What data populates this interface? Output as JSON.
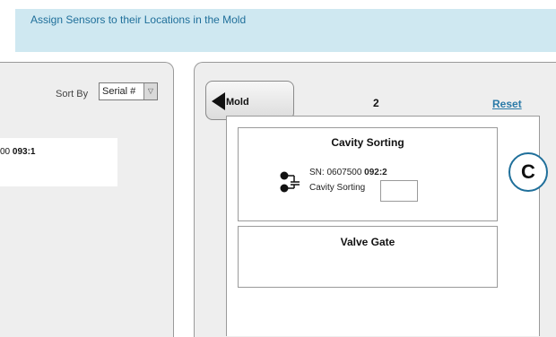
{
  "header": {
    "instruction": "Assign Sensors to their Locations in the Mold"
  },
  "left_panel": {
    "sort_label": "Sort By",
    "sort_selected": "Serial #",
    "sensor": {
      "prefix": "00 ",
      "suffix": "093:1"
    }
  },
  "toolbar": {
    "mold_label": "Mold",
    "cavity_count": "2",
    "reset_label": "Reset"
  },
  "sections": {
    "cavity": {
      "title": "Cavity Sorting",
      "sn_prefix": "SN: 0607500 ",
      "sn_suffix": "092:2",
      "location_label": "Cavity Sorting",
      "location_value": ""
    },
    "valve": {
      "title": "Valve Gate"
    }
  },
  "callout": {
    "letter": "C"
  },
  "colors": {
    "banner_bg": "#cfe8f1",
    "accent": "#1f6f9a",
    "link": "#2a7aa8",
    "panel_bg": "#eeeeee"
  },
  "icons": {
    "back": "left-arrow-icon",
    "sensor": "sensor-connector-icon",
    "dropdown": "chevron-down-icon"
  }
}
